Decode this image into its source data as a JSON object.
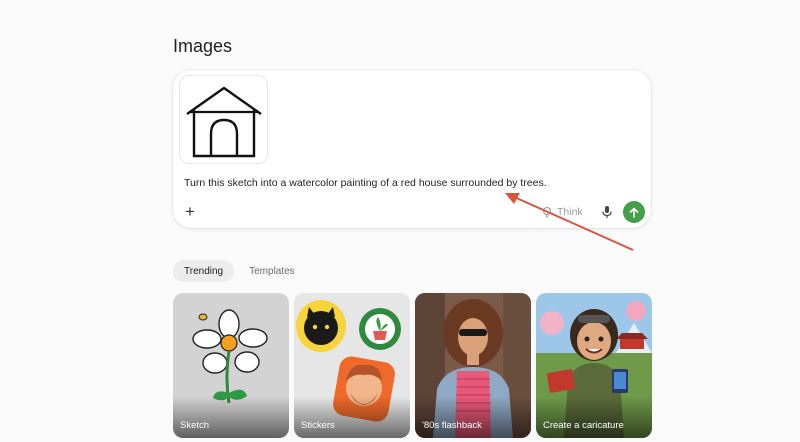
{
  "page": {
    "title": "Images"
  },
  "composer": {
    "prompt": "Turn this sketch into a watercolor painting of a red house surrounded by trees.",
    "add_label": "+",
    "think_label": "Think",
    "mic_icon": "microphone-icon",
    "send_icon": "arrow-up-icon",
    "send_color": "#43a047"
  },
  "tabs": [
    {
      "label": "Trending",
      "active": true
    },
    {
      "label": "Templates",
      "active": false
    }
  ],
  "cards": [
    {
      "label": "Sketch"
    },
    {
      "label": "Stickers"
    },
    {
      "label": "'80s flashback"
    },
    {
      "label": "Create a caricature"
    }
  ],
  "annotation": {
    "arrow_color": "#d9533f"
  }
}
